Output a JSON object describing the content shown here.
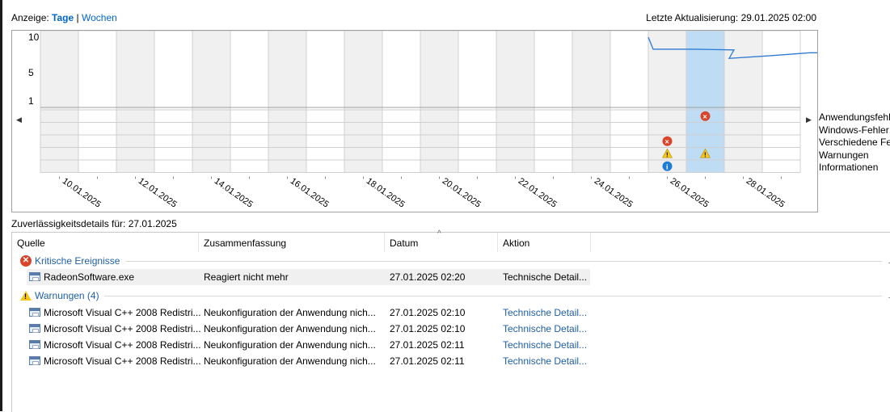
{
  "header": {
    "view_label": "Anzeige:",
    "view_days": "Tage",
    "view_sep": "|",
    "view_weeks": "Wochen",
    "last_update": "Letzte Aktualisierung: 29.01.2025 02:00"
  },
  "chart": {
    "y_ticks": [
      "10",
      "5",
      "1"
    ],
    "date_labels": [
      "10.01.2025",
      "12.01.2025",
      "14.01.2025",
      "16.01.2025",
      "18.01.2025",
      "20.01.2025",
      "22.01.2025",
      "24.01.2025",
      "26.01.2025",
      "28.01.2025"
    ],
    "categories": [
      "Anwendungsfehler",
      "Windows-Fehler",
      "Verschiedene Fehler",
      "Warnungen",
      "Informationen"
    ],
    "selected_day_index": 17,
    "stability_index": [
      {
        "day": "25.01.2025",
        "value": 10
      },
      {
        "day": "25.01.2025",
        "value": 8.3
      },
      {
        "day": "26.01.2025",
        "value": 8.3
      },
      {
        "day": "27.01.2025",
        "value": 8.2
      },
      {
        "day": "27.01.2025",
        "value": 7.0
      },
      {
        "day": "28.01.2025",
        "value": 7.4
      },
      {
        "day": "29.01.2025",
        "value": 7.8
      },
      {
        "day": "30.01.2025",
        "value": 7.8
      }
    ],
    "events": [
      {
        "day_index": 17,
        "category": "Anwendungsfehler",
        "icon": "error-icon"
      },
      {
        "day_index": 16,
        "category": "Verschiedene Fehler",
        "icon": "error-icon"
      },
      {
        "day_index": 16,
        "category": "Warnungen",
        "icon": "warning-icon"
      },
      {
        "day_index": 17,
        "category": "Warnungen",
        "icon": "warning-icon"
      },
      {
        "day_index": 16,
        "category": "Informationen",
        "icon": "info-icon"
      }
    ],
    "colors": {
      "line": "#2f7bd1",
      "selected_column": "#bfdcf5",
      "shaded_column": "#f0f0f0",
      "error": "#d9452b",
      "warning": "#f5c518",
      "info": "#1e7bd6"
    }
  },
  "details": {
    "label": "Zuverlässigkeitsdetails für: 27.01.2025"
  },
  "table": {
    "columns": [
      "Quelle",
      "Zusammenfassung",
      "Datum",
      "Aktion"
    ],
    "groups": [
      {
        "title": "Kritische Ereignisse",
        "icon": "error-icon",
        "rows": [
          {
            "source": "RadeonSoftware.exe",
            "summary": "Reagiert nicht mehr",
            "date": "27.01.2025 02:20",
            "action": "Technische Detail..."
          }
        ]
      },
      {
        "title": "Warnungen (4)",
        "icon": "warning-icon",
        "rows": [
          {
            "source": "Microsoft Visual C++ 2008 Redistri...",
            "summary": "Neukonfiguration der Anwendung nich...",
            "date": "27.01.2025 02:10",
            "action": "Technische Detail..."
          },
          {
            "source": "Microsoft Visual C++ 2008 Redistri...",
            "summary": "Neukonfiguration der Anwendung nich...",
            "date": "27.01.2025 02:10",
            "action": "Technische Detail..."
          },
          {
            "source": "Microsoft Visual C++ 2008 Redistri...",
            "summary": "Neukonfiguration der Anwendung nich...",
            "date": "27.01.2025 02:11",
            "action": "Technische Detail..."
          },
          {
            "source": "Microsoft Visual C++ 2008 Redistri...",
            "summary": "Neukonfiguration der Anwendung nich...",
            "date": "27.01.2025 02:11",
            "action": "Technische Detail..."
          }
        ]
      }
    ]
  }
}
